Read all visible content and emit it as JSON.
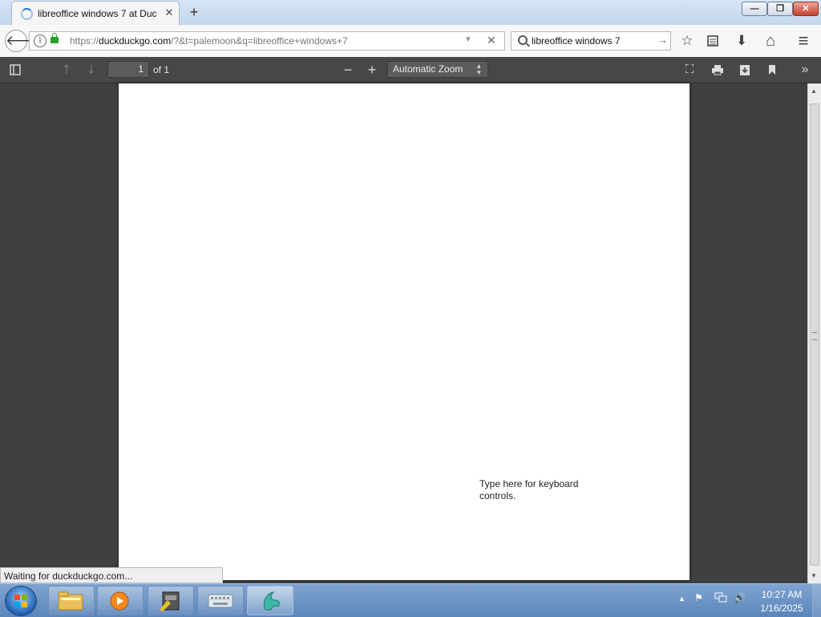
{
  "tab": {
    "title": "libreoffice windows 7 at Duc",
    "close": "✕"
  },
  "newtab": "+",
  "window": {
    "minimize": "—",
    "maximize": "❐",
    "close": "✕"
  },
  "nav": {
    "url_prefix": "https://",
    "url_host": "duckduckgo.com",
    "url_path": "/?&t=palemoon&q=libreoffice+windows+7",
    "search_value": "libreoffice windows 7"
  },
  "pdf": {
    "page_number": "1",
    "page_of": "of 1",
    "zoom": "Automatic Zoom",
    "keyboard_hint": "Type here for keyboard controls."
  },
  "status": "Waiting for duckduckgo.com...",
  "clock": {
    "time": "10:27 AM",
    "date": "1/16/2025"
  },
  "icons": {
    "back": "🡐",
    "info": "i",
    "stop": "✕",
    "search_go": "→",
    "bookmark": "☆",
    "downloads": "⬇",
    "home": "⌂",
    "menu": "≡"
  }
}
